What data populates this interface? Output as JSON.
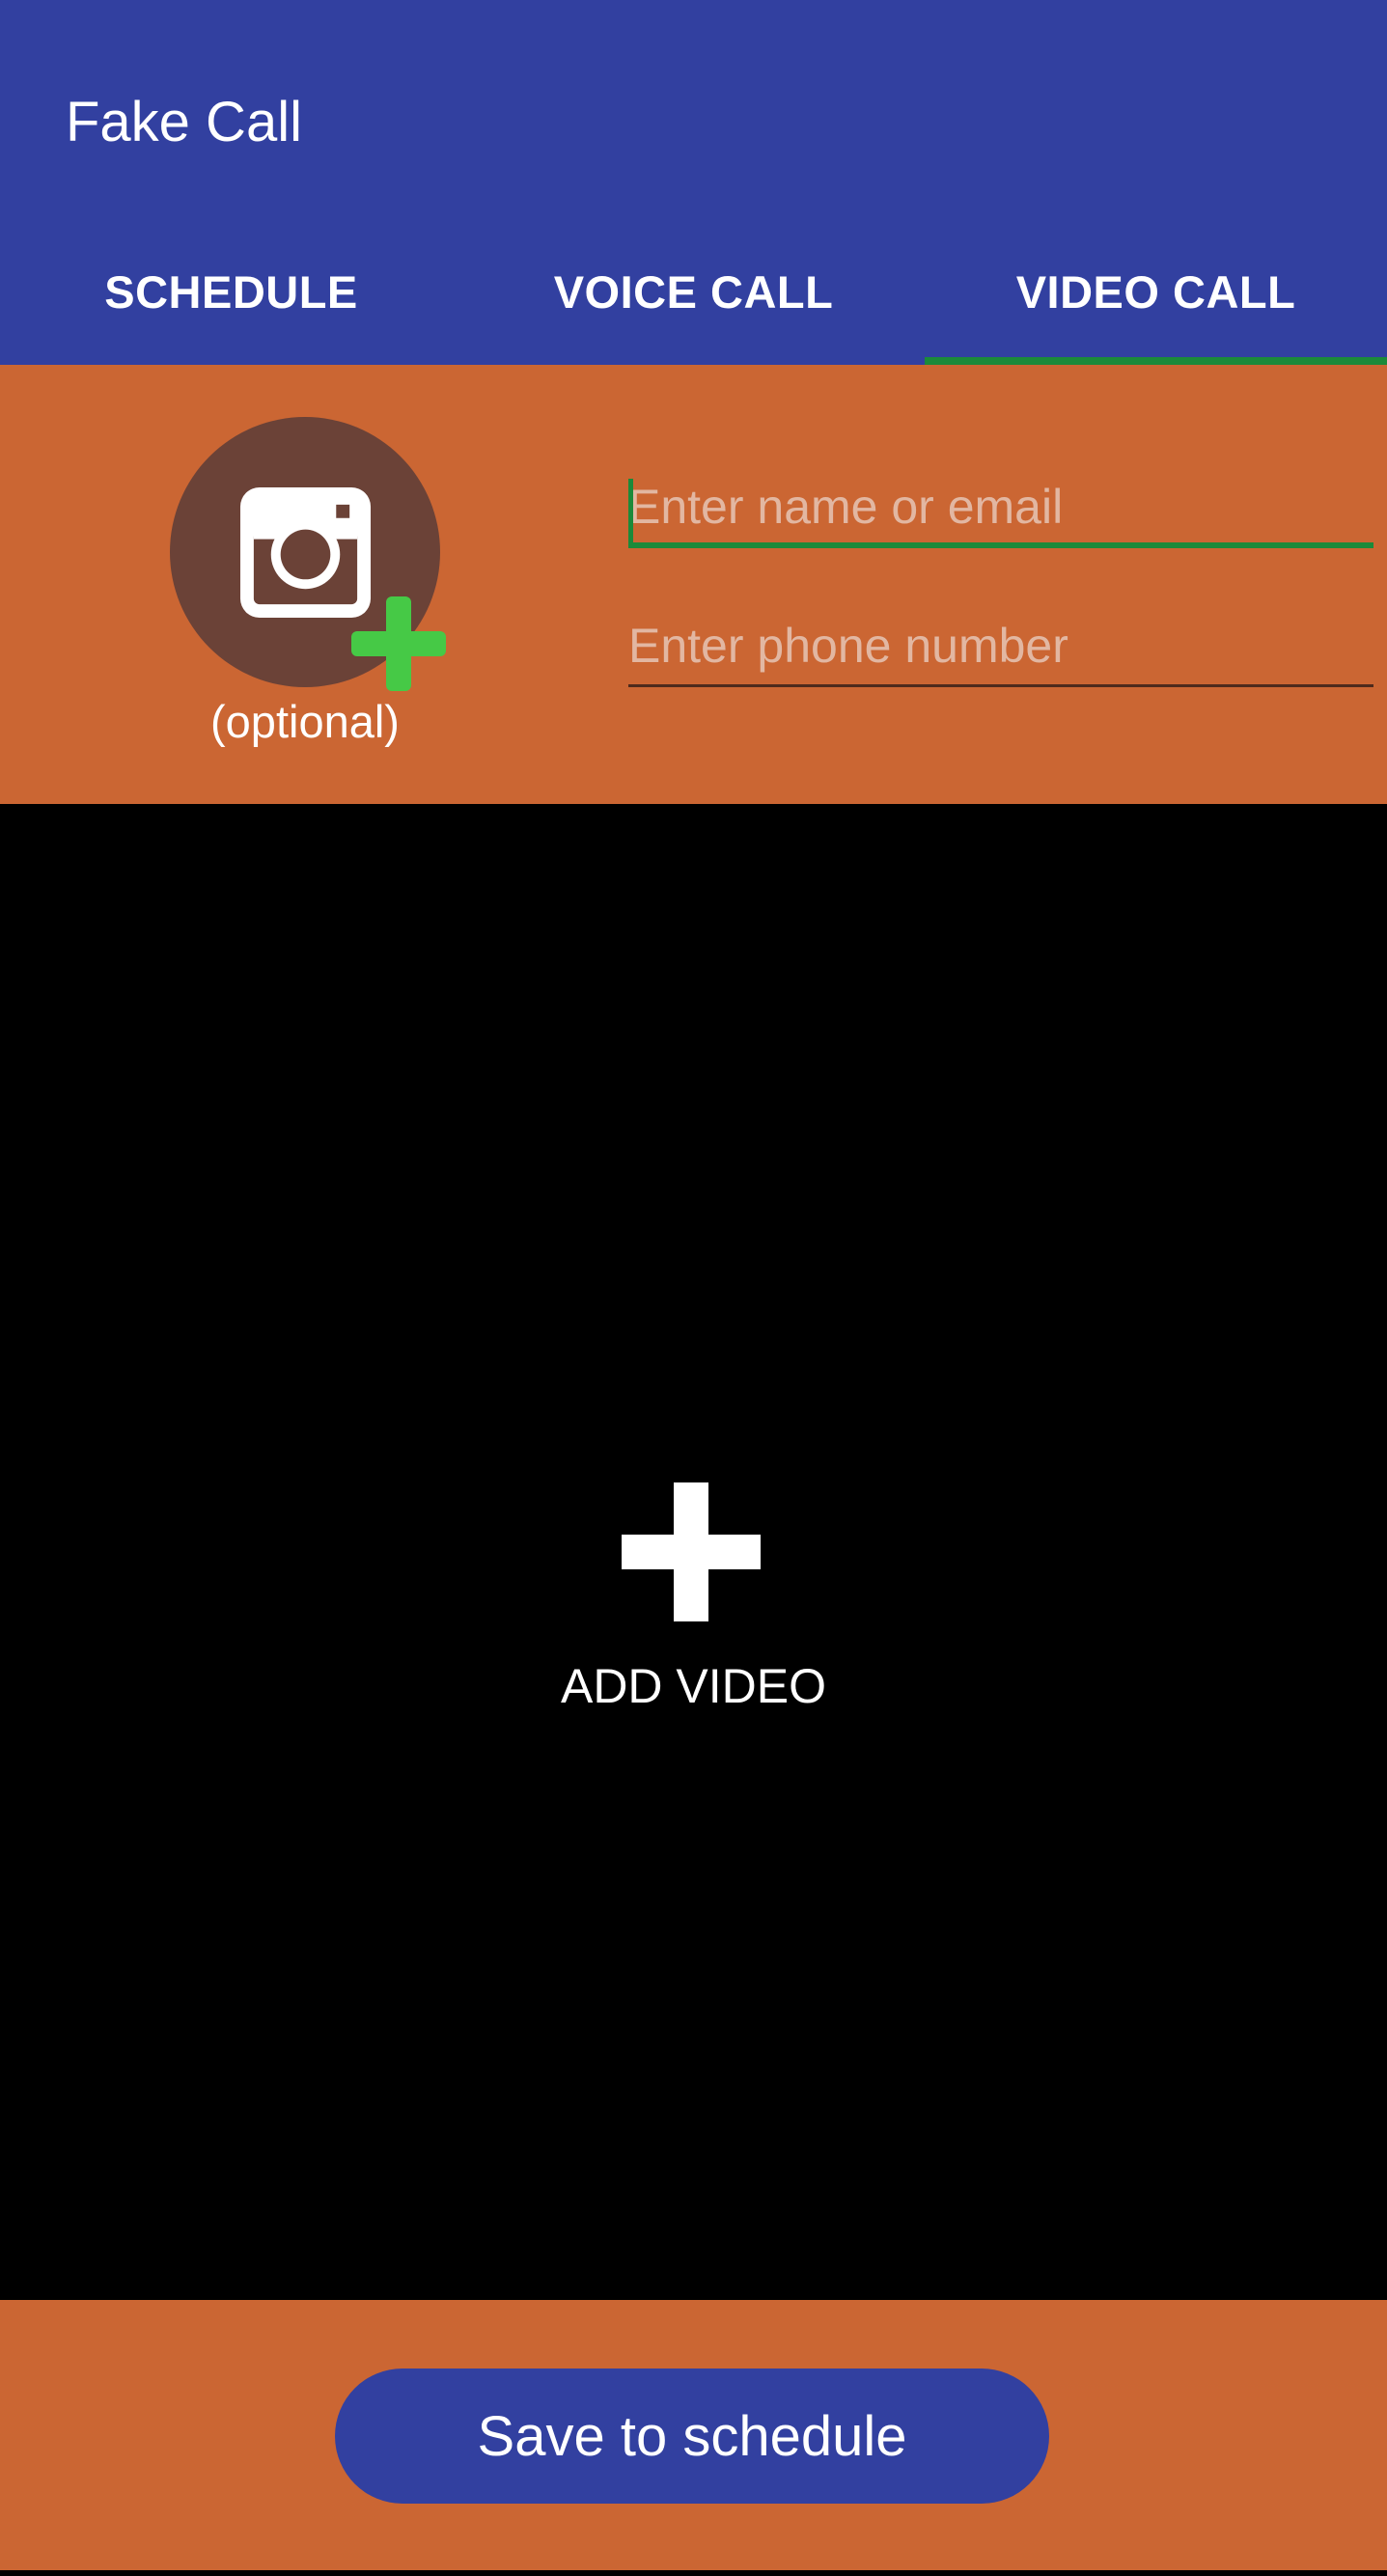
{
  "app": {
    "title": "Fake Call"
  },
  "tabs": [
    {
      "label": "SCHEDULE",
      "active": false
    },
    {
      "label": "VOICE CALL",
      "active": false
    },
    {
      "label": "VIDEO CALL",
      "active": true
    }
  ],
  "contact": {
    "photo_icon": "camera-icon",
    "photo_badge_icon": "add-plus-icon",
    "photo_caption": "(optional)",
    "name_placeholder": "Enter name or email",
    "name_value": "",
    "phone_placeholder": "Enter phone number",
    "phone_value": ""
  },
  "video": {
    "add_icon": "plus-icon",
    "add_label": "ADD VIDEO"
  },
  "actions": {
    "save_label": "Save to schedule"
  },
  "colors": {
    "primary": "#3240A0",
    "accent": "#CB6633",
    "indicator": "#1B8A3A",
    "avatar_bg": "#6B4237",
    "badge_green": "#46C946"
  }
}
